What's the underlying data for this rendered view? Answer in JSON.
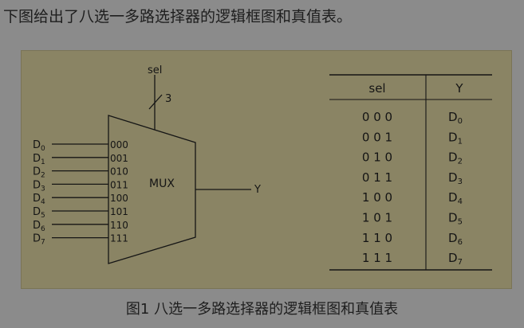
{
  "intro_text": "下图给出了八选一多路选择器的逻辑框图和真值表。",
  "caption": "图1 八选一多路选择器的逻辑框图和真值表",
  "mux": {
    "label": "MUX",
    "label_color": "#9c1d1d",
    "sel_label": "sel",
    "sel_width": "3",
    "output_label": "Y",
    "inputs": [
      {
        "name": "D",
        "sub": "0",
        "code": "000"
      },
      {
        "name": "D",
        "sub": "1",
        "code": "001"
      },
      {
        "name": "D",
        "sub": "2",
        "code": "010"
      },
      {
        "name": "D",
        "sub": "3",
        "code": "011"
      },
      {
        "name": "D",
        "sub": "4",
        "code": "100"
      },
      {
        "name": "D",
        "sub": "5",
        "code": "101"
      },
      {
        "name": "D",
        "sub": "6",
        "code": "110"
      },
      {
        "name": "D",
        "sub": "7",
        "code": "111"
      }
    ]
  },
  "truth_table": {
    "headers": [
      "sel",
      "Y"
    ],
    "rows": [
      {
        "sel": "0 0 0",
        "y": "D",
        "sub": "0"
      },
      {
        "sel": "0 0 1",
        "y": "D",
        "sub": "1"
      },
      {
        "sel": "0 1 0",
        "y": "D",
        "sub": "2"
      },
      {
        "sel": "0 1 1",
        "y": "D",
        "sub": "3"
      },
      {
        "sel": "1 0 0",
        "y": "D",
        "sub": "4"
      },
      {
        "sel": "1 0 1",
        "y": "D",
        "sub": "5"
      },
      {
        "sel": "1 1 0",
        "y": "D",
        "sub": "6"
      },
      {
        "sel": "1 1 1",
        "y": "D",
        "sub": "7"
      }
    ]
  },
  "colors": {
    "page_bg": "#8b8b8b",
    "panel_bg": "#8a8464",
    "ink": "#151515"
  }
}
